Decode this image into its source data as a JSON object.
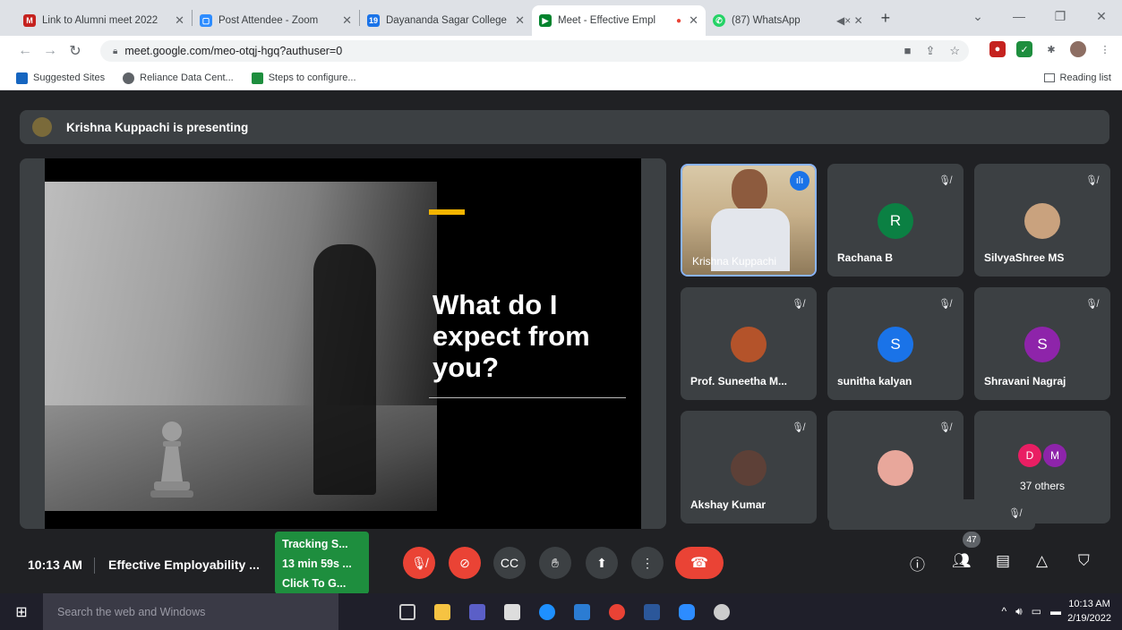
{
  "browser": {
    "tabs": [
      {
        "title": "Link to Alumni meet 2022",
        "color": "#c5221f",
        "glyph": "M"
      },
      {
        "title": "Post Attendee - Zoom",
        "color": "#2d8cff",
        "glyph": "▢"
      },
      {
        "title": "Dayananda Sagar College",
        "color": "#1a73e8",
        "glyph": "19"
      },
      {
        "title": "Meet - Effective Empl",
        "color": "#00832d",
        "glyph": "▶"
      },
      {
        "title": "(87) WhatsApp",
        "color": "#25d366",
        "glyph": "✆"
      }
    ],
    "url": "meet.google.com/meo-otqj-hgq?authuser=0",
    "bookmarks": [
      "Suggested Sites",
      "Reliance Data Cent...",
      "Steps to configure..."
    ],
    "reading_list": "Reading list"
  },
  "meet": {
    "presenter_banner": "Krishna Kuppachi is presenting",
    "slide": {
      "title": "What do I expect from you?"
    },
    "participants": [
      {
        "name": "Krishna Kuppachi",
        "kind": "video",
        "speaking": true
      },
      {
        "name": "Rachana B",
        "initial": "R",
        "color": "#0b8043"
      },
      {
        "name": "SilvyaShree MS",
        "kind": "photo",
        "color": "#c9a27e"
      },
      {
        "name": "Prof. Suneetha M...",
        "kind": "photo",
        "color": "#b4532a"
      },
      {
        "name": "sunitha kalyan",
        "initial": "S",
        "color": "#1a73e8"
      },
      {
        "name": "Shravani Nagraj",
        "initial": "S",
        "color": "#8e24aa"
      },
      {
        "name": "Akshay Kumar",
        "kind": "photo",
        "color": "#5d4037"
      },
      {
        "name": "",
        "kind": "photo",
        "color": "#e8a79b"
      }
    ],
    "others": {
      "label": "37 others",
      "initials": [
        "D",
        "M"
      ],
      "colors": [
        "#e91e63",
        "#8e24aa"
      ]
    },
    "time": "10:13 AM",
    "meeting_title": "Effective Employability ...",
    "tracker": [
      "Tracking S...",
      "13 min 59s ...",
      "Click To G..."
    ],
    "people_count": "47"
  },
  "taskbar": {
    "search_placeholder": "Search the web and Windows",
    "time": "10:13 AM",
    "date": "2/19/2022"
  }
}
